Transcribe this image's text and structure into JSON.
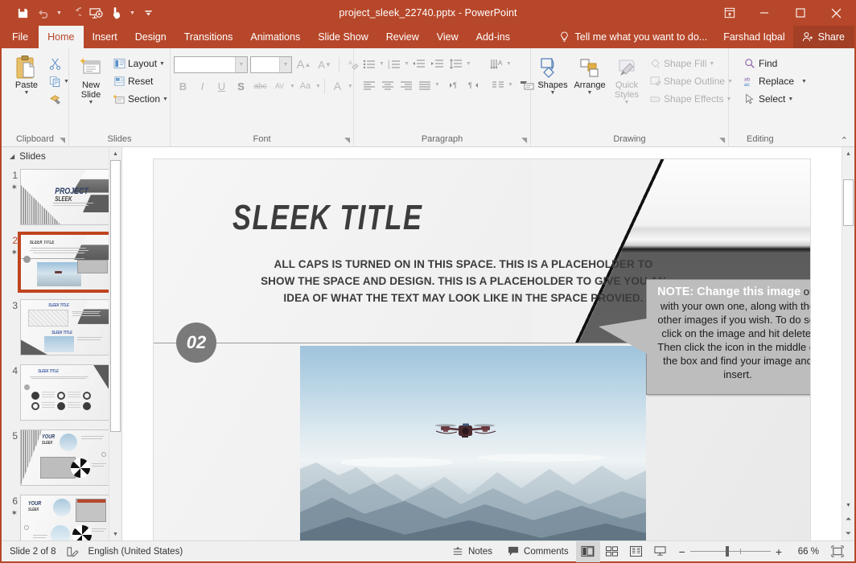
{
  "window": {
    "title": "project_sleek_22740.pptx - PowerPoint",
    "brand_color": "#b7472a",
    "qat": [
      {
        "name": "save-button",
        "icon": "save-icon",
        "label": "Save"
      },
      {
        "name": "undo-button",
        "icon": "undo-icon",
        "label": "Undo"
      },
      {
        "name": "redo-button",
        "icon": "redo-icon",
        "label": "Redo"
      },
      {
        "name": "start-from-beginning-button",
        "icon": "slideshow-icon",
        "label": "Start From Beginning"
      },
      {
        "name": "touch-mouse-mode-button",
        "icon": "touch-mode-icon",
        "label": "Touch/Mouse Mode"
      },
      {
        "name": "customize-qat-button",
        "icon": "chevron-down-icon",
        "label": "Customize Quick Access Toolbar"
      }
    ],
    "controls": {
      "ribbon_display": "Ribbon Display Options",
      "minimize": "Minimize",
      "restore": "Restore Down",
      "close": "Close"
    }
  },
  "tabs": [
    {
      "label": "File",
      "active": false
    },
    {
      "label": "Home",
      "active": true
    },
    {
      "label": "Insert",
      "active": false
    },
    {
      "label": "Design",
      "active": false
    },
    {
      "label": "Transitions",
      "active": false
    },
    {
      "label": "Animations",
      "active": false
    },
    {
      "label": "Slide Show",
      "active": false
    },
    {
      "label": "Review",
      "active": false
    },
    {
      "label": "View",
      "active": false
    },
    {
      "label": "Add-ins",
      "active": false
    }
  ],
  "tellme": {
    "label": "Tell me what you want to do...",
    "icon": "lightbulb-icon"
  },
  "account": {
    "user": "Farshad Iqbal",
    "share_label": "Share",
    "share_icon": "share-person-icon"
  },
  "ribbon": {
    "collapse_label": "Collapse the Ribbon",
    "groups": [
      {
        "name": "clipboard",
        "label": "Clipboard",
        "paste": {
          "label": "Paste",
          "icon": "paste-icon"
        },
        "items": [
          {
            "label": "Cut",
            "icon": "scissors-icon"
          },
          {
            "label": "Copy",
            "icon": "copy-icon"
          },
          {
            "label": "Format Painter",
            "icon": "format-painter-icon"
          }
        ]
      },
      {
        "name": "slides",
        "label": "Slides",
        "new_slide": {
          "label": "New Slide",
          "icon": "new-slide-icon"
        },
        "items": [
          {
            "label": "Layout",
            "icon": "layout-icon"
          },
          {
            "label": "Reset",
            "icon": "reset-icon"
          },
          {
            "label": "Section",
            "icon": "section-icon"
          }
        ]
      },
      {
        "name": "font",
        "label": "Font",
        "font_name": {
          "value": "",
          "placeholder": ""
        },
        "font_size": {
          "value": "",
          "placeholder": ""
        },
        "buttons": [
          {
            "label": "Increase Font Size",
            "glyph": "A"
          },
          {
            "label": "Decrease Font Size",
            "glyph": "A"
          },
          {
            "label": "Clear All Formatting",
            "glyph": "clear-formatting-icon"
          },
          {
            "label": "Bold",
            "glyph": "B"
          },
          {
            "label": "Italic",
            "glyph": "I"
          },
          {
            "label": "Underline",
            "glyph": "U"
          },
          {
            "label": "Text Shadow",
            "glyph": "S"
          },
          {
            "label": "Strikethrough",
            "glyph": "abc"
          },
          {
            "label": "Character Spacing",
            "glyph": "AV"
          },
          {
            "label": "Change Case",
            "glyph": "Aa"
          },
          {
            "label": "Font Color",
            "glyph": "A"
          }
        ]
      },
      {
        "name": "paragraph",
        "label": "Paragraph",
        "buttons": [
          {
            "label": "Bullets",
            "icon": "bullets-icon"
          },
          {
            "label": "Numbering",
            "icon": "numbering-icon"
          },
          {
            "label": "Decrease List Level",
            "icon": "decrease-indent-icon"
          },
          {
            "label": "Increase List Level",
            "icon": "increase-indent-icon"
          },
          {
            "label": "Line Spacing",
            "icon": "line-spacing-icon"
          },
          {
            "label": "Align Left",
            "icon": "align-left-icon"
          },
          {
            "label": "Center",
            "icon": "align-center-icon"
          },
          {
            "label": "Align Right",
            "icon": "align-right-icon"
          },
          {
            "label": "Justify",
            "icon": "justify-icon"
          },
          {
            "label": "Left-to-Right Text Direction",
            "icon": "ltr-icon"
          },
          {
            "label": "Right-to-Left Text Direction",
            "icon": "rtl-icon"
          },
          {
            "label": "Columns",
            "icon": "columns-icon"
          },
          {
            "label": "Text Direction",
            "icon": "text-direction-icon"
          },
          {
            "label": "Align Text",
            "icon": "align-text-icon"
          },
          {
            "label": "Convert to SmartArt",
            "icon": "smartart-icon"
          }
        ]
      },
      {
        "name": "drawing",
        "label": "Drawing",
        "items": [
          {
            "label": "Shapes",
            "icon": "shapes-icon"
          },
          {
            "label": "Arrange",
            "icon": "arrange-icon"
          },
          {
            "label": "Quick Styles",
            "icon": "quick-styles-icon"
          }
        ],
        "small_items": [
          {
            "label": "Shape Fill",
            "icon": "fill-bucket-icon",
            "disabled": true
          },
          {
            "label": "Shape Outline",
            "icon": "outline-pen-icon",
            "disabled": true
          },
          {
            "label": "Shape Effects",
            "icon": "effects-icon",
            "disabled": true
          }
        ]
      },
      {
        "name": "editing",
        "label": "Editing",
        "items": [
          {
            "label": "Find",
            "icon": "search-icon"
          },
          {
            "label": "Replace",
            "icon": "replace-icon"
          },
          {
            "label": "Select",
            "icon": "cursor-select-icon"
          }
        ]
      }
    ]
  },
  "slides_panel": {
    "header": "Slides",
    "header_icon": "collapse-triangle-icon",
    "slides": [
      {
        "number": "1",
        "animated": true,
        "selected": false,
        "title": "PROJECT SLEEK"
      },
      {
        "number": "2",
        "animated": true,
        "selected": true,
        "title": "SLEEK TITLE"
      },
      {
        "number": "3",
        "animated": false,
        "selected": false,
        "title": "SLEEK TITLE"
      },
      {
        "number": "4",
        "animated": false,
        "selected": false,
        "title": "SLEEK TITLE"
      },
      {
        "number": "5",
        "animated": false,
        "selected": false,
        "title": "YOUR SLEEK"
      },
      {
        "number": "6",
        "animated": true,
        "selected": false,
        "title": "YOUR SLEEK"
      }
    ]
  },
  "slide": {
    "title": "SLEEK TITLE",
    "body": "ALL CAPS IS TURNED ON IN THIS SPACE. THIS IS A PLACEHOLDER TO SHOW THE SPACE AND DESIGN. THIS IS A PLACEHOLDER TO GIVE YOU AN IDEA OF WHAT THE TEXT MAY LOOK LIKE IN THE SPACE PROVIED.",
    "badge": "02",
    "callout": {
      "heading": "NOTE: Change this image",
      "text": " out with your own one, along with the other images if you wish. To do so, click on the image and hit delete. Then click the  icon in the middle of the box and find your image and insert."
    },
    "image_alt": "drone-over-mountains-photo",
    "corner_image_alt": "architecture-photo"
  },
  "status": {
    "slide_count": "Slide 2 of 8",
    "spellcheck_icon": "spellcheck-icon",
    "language": "English (United States)",
    "notes": {
      "label": "Notes",
      "icon": "notes-icon"
    },
    "comments": {
      "label": "Comments",
      "icon": "comment-icon"
    },
    "views": [
      {
        "label": "Normal",
        "icon": "normal-view-icon",
        "active": true
      },
      {
        "label": "Slide Sorter",
        "icon": "slide-sorter-icon",
        "active": false
      },
      {
        "label": "Reading View",
        "icon": "reading-view-icon",
        "active": false
      },
      {
        "label": "Slide Show",
        "icon": "slideshow-view-icon",
        "active": false
      }
    ],
    "zoom": {
      "out": "−",
      "in": "+",
      "level": "66 %",
      "fit_label": "Fit slide to current window"
    }
  }
}
